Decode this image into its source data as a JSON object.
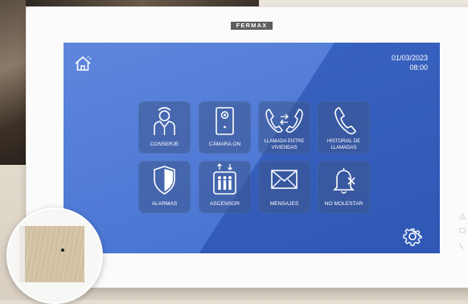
{
  "device": {
    "brand": "FERMAX"
  },
  "status": {
    "date": "01/03/2023",
    "time": "08:00"
  },
  "tiles": [
    {
      "label": "CONSERJE",
      "icon": "concierge-icon"
    },
    {
      "label": "CÁMARA ON",
      "icon": "camera-on-icon"
    },
    {
      "label": "LLAMADA ENTRE VIVIENDAS",
      "line1": "LLAMADA ENTRE",
      "line2": "VIVIENDAS",
      "icon": "intercom-call-icon"
    },
    {
      "label": "HISTORIAL DE LLAMADAS",
      "line1": "HISTORIAL DE",
      "line2": "LLAMADAS",
      "icon": "call-history-icon"
    },
    {
      "label": "ALARMAS",
      "icon": "alarm-shield-icon"
    },
    {
      "label": "ASCENSOR",
      "icon": "elevator-icon"
    },
    {
      "label": "MENSAJES",
      "icon": "envelope-icon"
    },
    {
      "label": "NO MOLESTAR",
      "icon": "bell-muted-icon"
    }
  ],
  "icons": {
    "home": "home-icon",
    "settings": "gear-icon"
  },
  "colors": {
    "screen": "#3f6ac9",
    "tile": "#3c558c",
    "text": "#ffffff",
    "device": "#fbfbfb"
  }
}
